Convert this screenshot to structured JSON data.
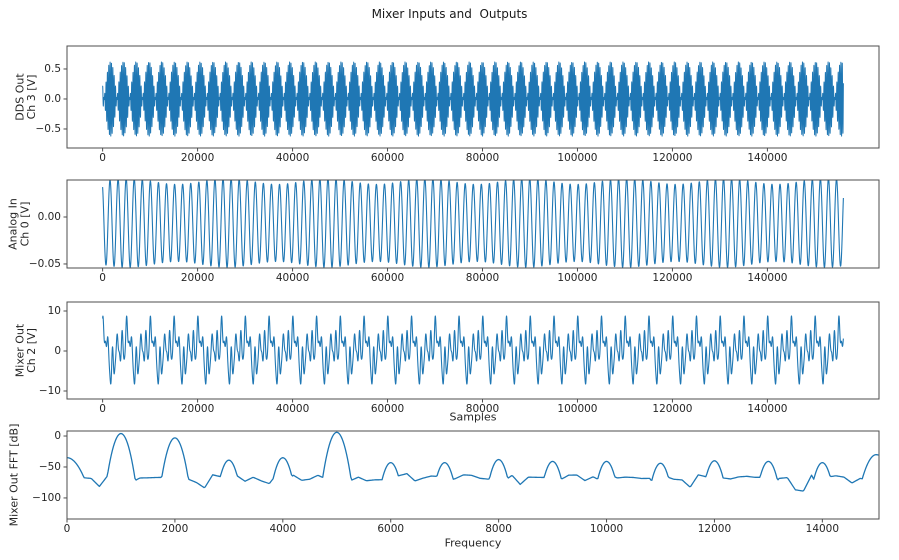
{
  "figure": {
    "title": "Mixer Inputs and  Outputs",
    "background": "#ffffff",
    "line_color": "#1f77b4",
    "spine_color": "#4d4d4d",
    "text_color": "#262626"
  },
  "chart_data": [
    {
      "type": "line",
      "name": "dds-out-ch3",
      "ylabel": "DDS Out\nCh 3 [V]",
      "xlabel": "",
      "xlim": [
        -7500,
        163500
      ],
      "ylim": [
        -0.817,
        0.883
      ],
      "xticks": [
        0,
        20000,
        40000,
        60000,
        80000,
        100000,
        120000,
        140000
      ],
      "xtick_labels": [
        "0",
        "20000",
        "40000",
        "60000",
        "80000",
        "100000",
        "120000",
        "140000"
      ],
      "yticks": [
        0.5,
        0.0,
        -0.5
      ],
      "ytick_labels": [
        "0.5",
        "0.0",
        "−0.5"
      ],
      "grid": false,
      "legend": null,
      "description": "Two-tone DDS output: beat-modulated carrier, envelope peaks ±0.62 V, beat period ≈2700 samples",
      "signal": {
        "kind": "sum",
        "lw": 1.0,
        "n_samples": 156000,
        "points": 9500,
        "offset": 0,
        "components": [
          {
            "period": 300,
            "amp": 0.31,
            "phase": 0
          },
          {
            "period": 270,
            "amp": 0.31,
            "phase": 2.4
          }
        ]
      }
    },
    {
      "type": "line",
      "name": "analog-in-ch0",
      "ylabel": "Analog In\nCh 0 [V]",
      "xlabel": "",
      "xlim": [
        -7500,
        163500
      ],
      "ylim": [
        -0.0543,
        0.0394
      ],
      "xticks": [
        0,
        20000,
        40000,
        60000,
        80000,
        100000,
        120000,
        140000
      ],
      "xtick_labels": [
        "0",
        "20000",
        "40000",
        "60000",
        "80000",
        "100000",
        "120000",
        "140000"
      ],
      "yticks": [
        0.0,
        -0.05
      ],
      "ytick_labels": [
        "0.00",
        "−0.05"
      ],
      "grid": false,
      "legend": null,
      "description": "Analog input sine ≈±0.044 V about −0.006 V offset, period ≈1700 samples",
      "signal": {
        "kind": "sum",
        "lw": 1.1,
        "n_samples": 156000,
        "points": 7000,
        "offset": -0.0063,
        "components": [
          {
            "period": 1700,
            "amp": 0.0442,
            "phase": 2.1,
            "am_period": 21000,
            "am_depth": 0.07
          }
        ]
      }
    },
    {
      "type": "line",
      "name": "mixer-out-ch2",
      "ylabel": "Mixer Out\nCh 2 [V]",
      "xlabel": "Samples",
      "xlim": [
        -7500,
        163500
      ],
      "ylim": [
        -12.0,
        12.25
      ],
      "xticks": [
        0,
        20000,
        40000,
        60000,
        80000,
        100000,
        120000,
        140000
      ],
      "xtick_labels": [
        "0",
        "20000",
        "40000",
        "60000",
        "80000",
        "100000",
        "120000",
        "140000"
      ],
      "yticks": [
        10,
        0,
        -10
      ],
      "ytick_labels": [
        "10",
        "0",
        "−10"
      ],
      "grid": false,
      "legend": null,
      "description": "Mixer output: periodic multi-harmonic waveform, motif ≈5000 samples, peaks ≈+10.5 V / −9.5 V",
      "signal": {
        "kind": "sum",
        "lw": 1.1,
        "n_samples": 156000,
        "points": 7000,
        "offset": 0.2,
        "components": [
          {
            "period": 5000,
            "amp": 3.1,
            "phase": 1.9
          },
          {
            "period": 2500,
            "amp": 2.3,
            "phase": 0.3
          },
          {
            "period": 1000,
            "amp": 3.4,
            "phase": 1.0
          },
          {
            "period": 714.3,
            "amp": 1.15,
            "phase": 2.2
          },
          {
            "period": 500,
            "amp": 0.9,
            "phase": 0.6
          }
        ]
      }
    },
    {
      "type": "line",
      "name": "mixer-out-fft",
      "ylabel": "Mixer Out FFT [dB]",
      "xlabel": "Frequency",
      "xlim": [
        0,
        15050
      ],
      "ylim": [
        -134,
        8.1
      ],
      "xticks": [
        0,
        2000,
        4000,
        6000,
        8000,
        10000,
        12000,
        14000
      ],
      "xtick_labels": [
        "0",
        "2000",
        "4000",
        "6000",
        "8000",
        "10000",
        "12000",
        "14000"
      ],
      "yticks": [
        0,
        -50,
        -100
      ],
      "ytick_labels": [
        "0",
        "−50",
        "−100"
      ],
      "grid": false,
      "legend": null,
      "description": "FFT of mixer output: noise floor ≈−68 dB with spurs every 1000 Hz; strongest tones at 1000, 2000 and 5000 Hz",
      "signal": {
        "kind": "fft",
        "lw": 1.3,
        "baseline": -68,
        "noise_amp": 5.5,
        "ctrl_step": 150,
        "peak_half_width": 110,
        "peaks": [
          {
            "freq": 0,
            "level": -35,
            "hw": 200
          },
          {
            "freq": 1000,
            "level": 4
          },
          {
            "freq": 2000,
            "level": -3
          },
          {
            "freq": 3000,
            "level": -39
          },
          {
            "freq": 4000,
            "level": -35
          },
          {
            "freq": 5000,
            "level": 6
          },
          {
            "freq": 6000,
            "level": -43
          },
          {
            "freq": 7000,
            "level": -43
          },
          {
            "freq": 8000,
            "level": -38
          },
          {
            "freq": 9000,
            "level": -41
          },
          {
            "freq": 10000,
            "level": -41
          },
          {
            "freq": 11000,
            "level": -44
          },
          {
            "freq": 12000,
            "level": -40
          },
          {
            "freq": 13000,
            "level": -41
          },
          {
            "freq": 14000,
            "level": -43
          },
          {
            "freq": 15000,
            "level": -30,
            "hw": 150
          }
        ]
      }
    }
  ]
}
